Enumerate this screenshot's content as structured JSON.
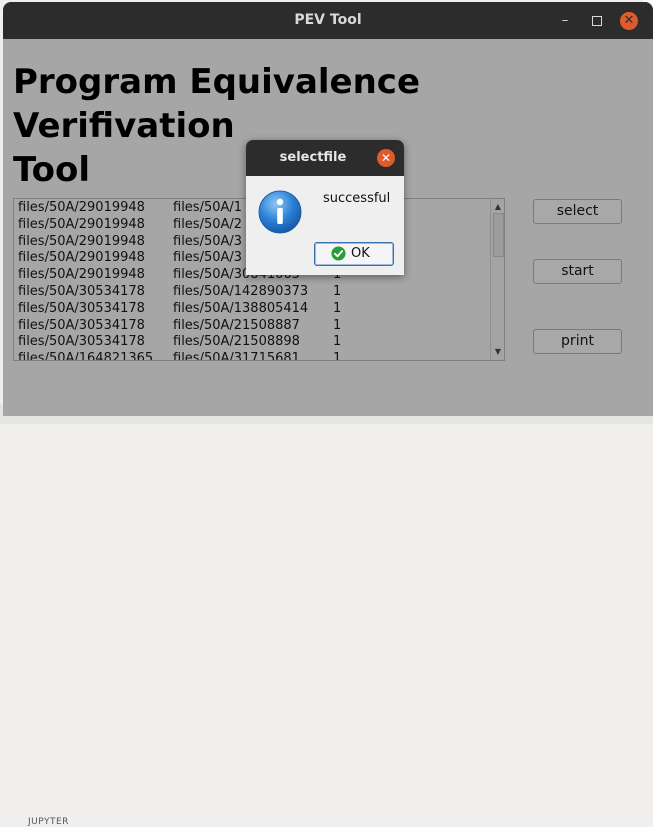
{
  "window": {
    "title": "PEV Tool",
    "minimize_glyph": "–",
    "close_glyph": "✕"
  },
  "app": {
    "title_line1": "Program Equivalence",
    "title_line2": "Verifivation",
    "title_line3": "Tool"
  },
  "list": {
    "rows": [
      [
        "files/50A/29019948",
        "files/50A/1",
        ""
      ],
      [
        "files/50A/29019948",
        "files/50A/2",
        ""
      ],
      [
        "files/50A/29019948",
        "files/50A/3",
        ""
      ],
      [
        "files/50A/29019948",
        "files/50A/3",
        ""
      ],
      [
        "files/50A/29019948",
        "files/50A/30841063",
        "1"
      ],
      [
        "files/50A/30534178",
        "files/50A/142890373",
        "1"
      ],
      [
        "files/50A/30534178",
        "files/50A/138805414",
        "1"
      ],
      [
        "files/50A/30534178",
        "files/50A/21508887",
        "1"
      ],
      [
        "files/50A/30534178",
        "files/50A/21508898",
        "1"
      ],
      [
        "files/50A/164821365",
        "files/50A/31715681",
        "1"
      ]
    ],
    "scroll_up": "▲",
    "scroll_down": "▼"
  },
  "buttons": {
    "select": "select",
    "start": "start",
    "print": "print"
  },
  "dialog": {
    "title": "selectfile",
    "message": "successful",
    "ok_label": "OK",
    "close_glyph": "✕",
    "icon": "info-icon"
  },
  "background": {
    "bottom_text": "JUPYTER"
  },
  "colors": {
    "titlebar": "#2c2c2c",
    "window_bg": "#a6a6a6",
    "close_accent": "#e05a2b",
    "info_blue": "#2a7fd4",
    "ok_green": "#2a9d3a"
  }
}
